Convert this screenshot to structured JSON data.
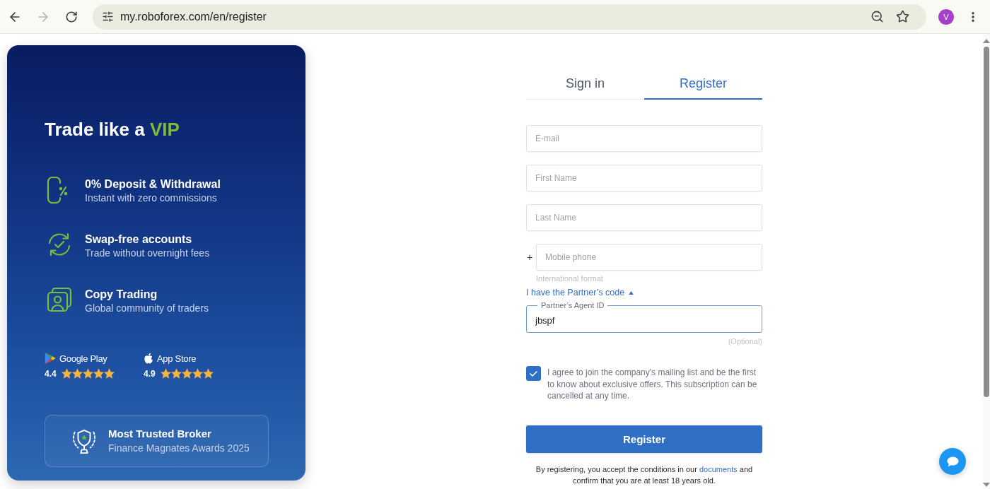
{
  "browser": {
    "back_disabled": false,
    "forward_disabled": true,
    "url": "my.roboforex.com/en/register",
    "profile_initial": "V"
  },
  "promo": {
    "title": "Trade like a",
    "title_highlight": "VIP",
    "features": [
      {
        "kind": "deposit",
        "title": "0% Deposit & Withdrawal",
        "subtitle": "Instant with zero commissions"
      },
      {
        "kind": "swap",
        "title": "Swap-free accounts",
        "subtitle": "Trade without overnight fees"
      },
      {
        "kind": "copy",
        "title": "Copy Trading",
        "subtitle": "Global community of traders"
      }
    ],
    "stores": [
      {
        "kind": "google",
        "name": "Google Play",
        "rating": "4.4",
        "stars": 5
      },
      {
        "kind": "apple",
        "name": "App Store",
        "rating": "4.9",
        "stars": 5
      }
    ],
    "award": {
      "title": "Most Trusted Broker",
      "subtitle": "Finance Magnates Awards 2025"
    }
  },
  "auth_tabs": [
    {
      "label": "Sign in",
      "selected": false
    },
    {
      "label": "Register",
      "selected": true
    }
  ],
  "form": {
    "fields": [
      {
        "kind": "email",
        "placeholder": "E-mail"
      },
      {
        "kind": "name",
        "placeholder": "First Name"
      },
      {
        "kind": "name",
        "placeholder": "Last Name"
      },
      {
        "kind": "phone",
        "prefix": "+",
        "placeholder": "Mobile phone",
        "hint": "International format"
      }
    ],
    "partner_toggle": {
      "label": "I have the Partner’s code",
      "expanded": true
    },
    "partner_field": {
      "label": "Partner’s Agent ID",
      "value": "jbspf",
      "note": "(Optional)"
    },
    "consent": {
      "checked": true,
      "text": "I agree to join the company's mailing list and be the first to know about exclusive offers. This subscription can be cancelled at any time."
    },
    "submit": "Register",
    "legal": {
      "before": "By registering, you accept the conditions in our",
      "link": "documents",
      "after": "and confirm that you are at least 18 years old."
    }
  }
}
